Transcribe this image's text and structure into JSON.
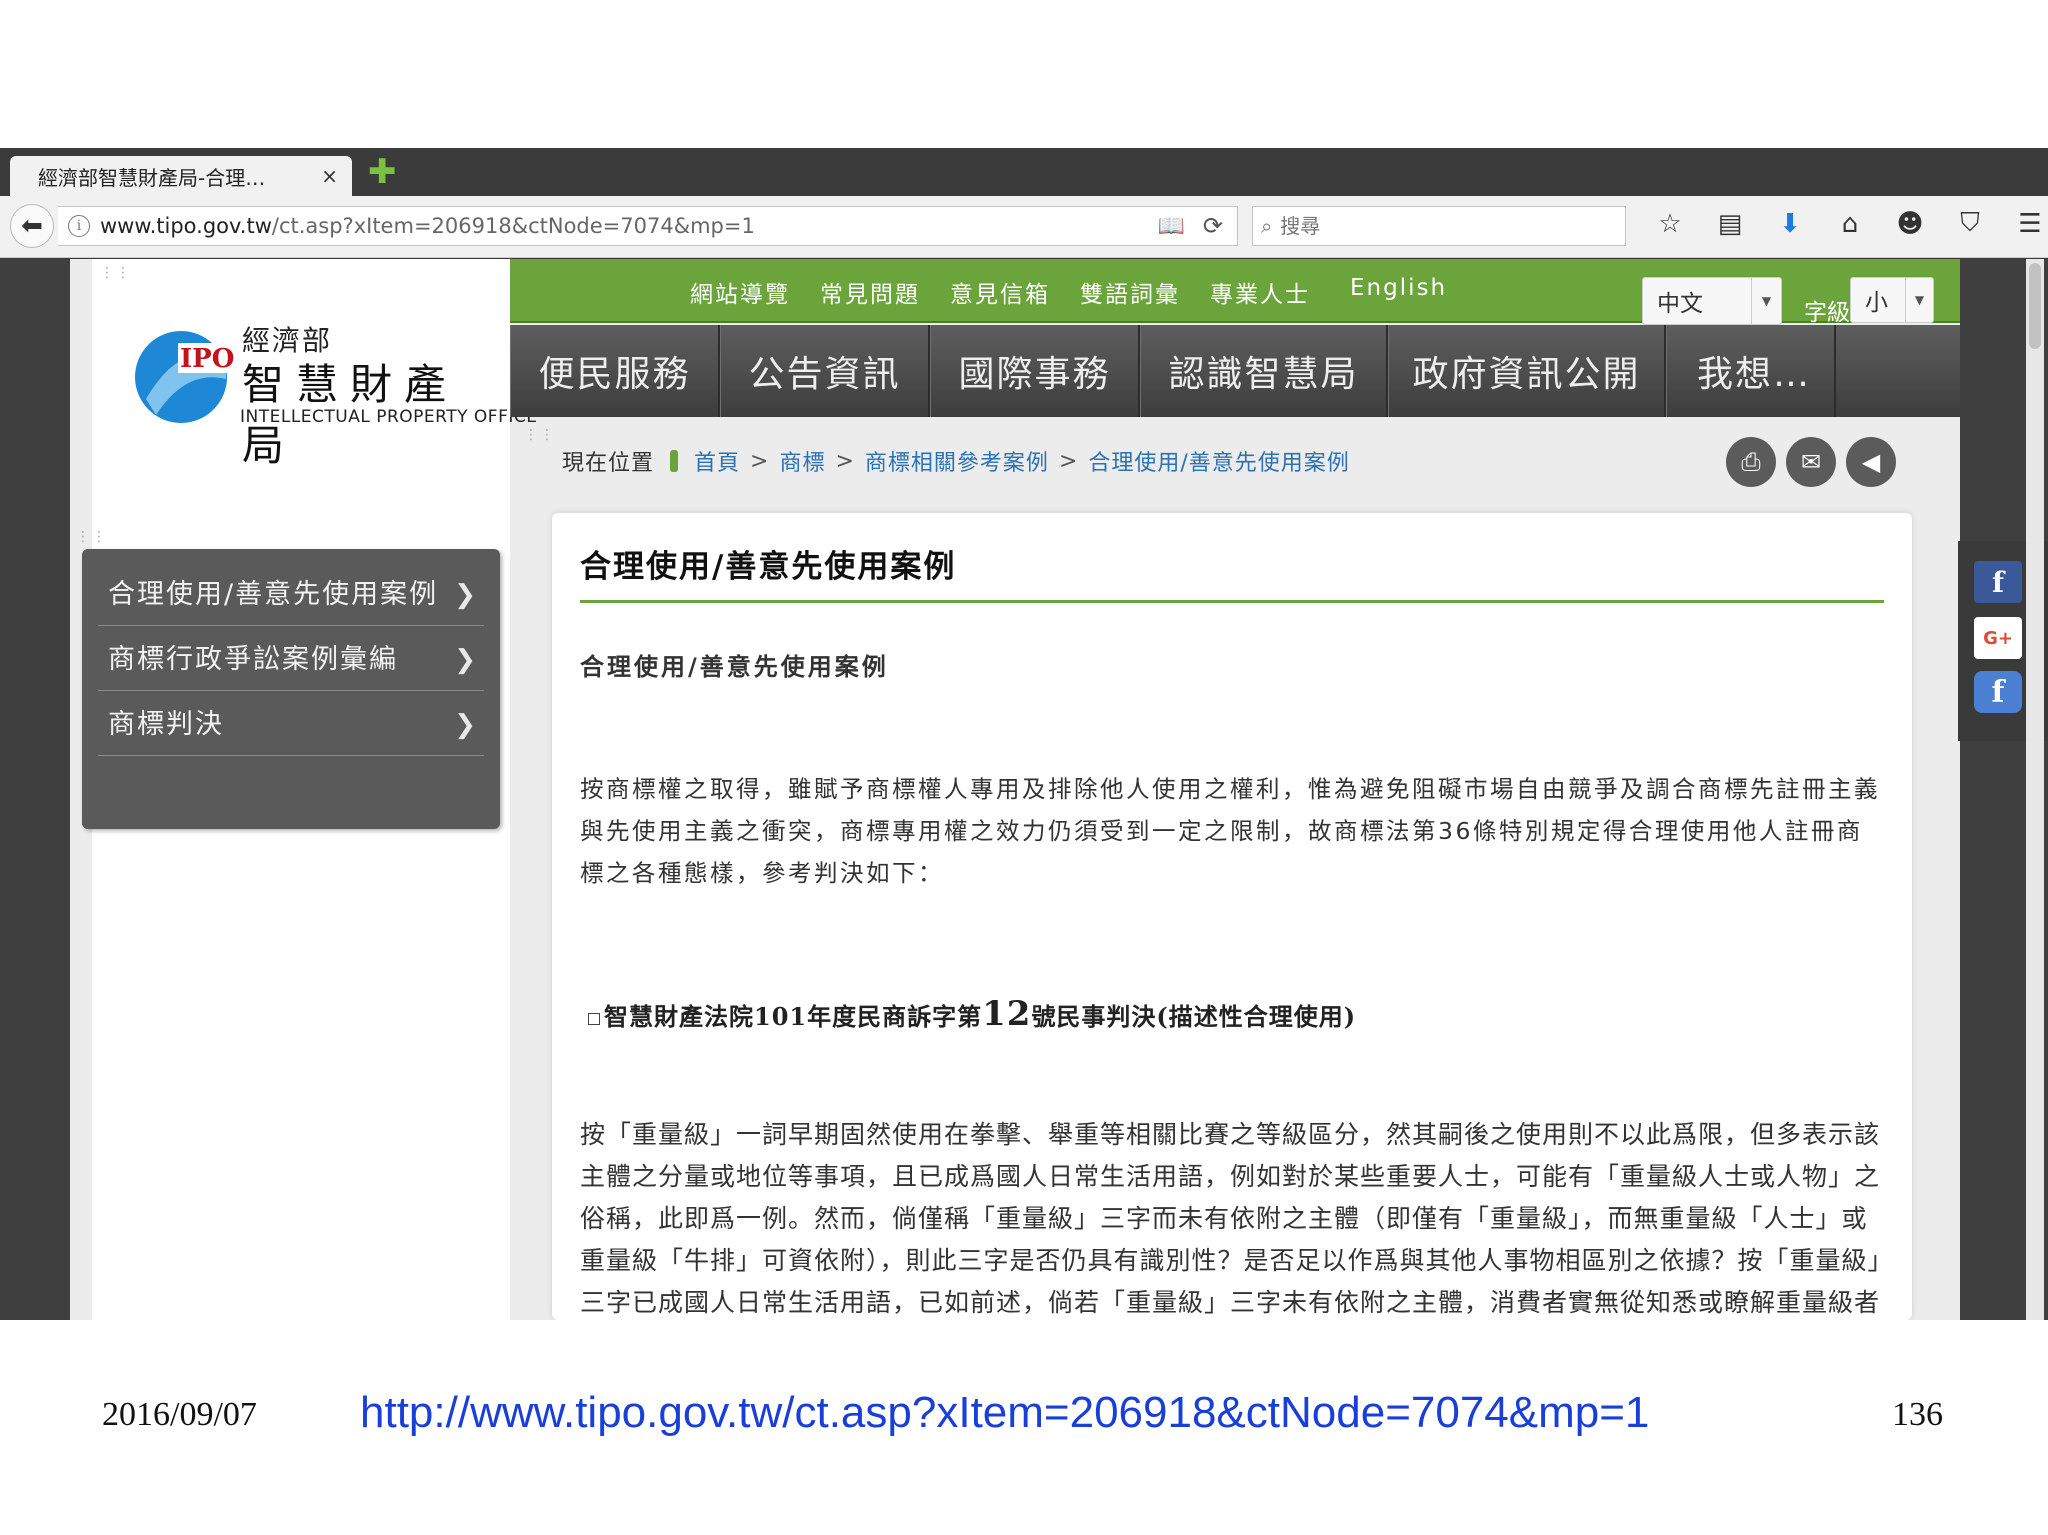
{
  "browser": {
    "tab_title": "經濟部智慧財產局-合理…",
    "tab_close": "×",
    "new_tab": "✚",
    "url_domain": "www.tipo.gov.tw",
    "url_path": "/ct.asp?xItem=206918&ctNode=7074&mp=1",
    "search_placeholder": "搜尋"
  },
  "site": {
    "logo": {
      "mark": "IPO",
      "cn_top": "經濟部",
      "cn_main": "智慧財產局",
      "en": "INTELLECTUAL PROPERTY OFFICE"
    },
    "top_nav": [
      "網站導覽",
      "常見問題",
      "意見信箱",
      "雙語詞彙",
      "專業人士",
      "English"
    ],
    "language": "中文",
    "font_size_label": "字級",
    "font_size": "小",
    "main_nav": [
      "便民服務",
      "公告資訊",
      "國際事務",
      "認識智慧局",
      "政府資訊公開",
      "我想…"
    ],
    "breadcrumb": {
      "label": "現在位置",
      "items": [
        "首頁",
        "商標",
        "商標相關參考案例",
        "合理使用/善意先使用案例"
      ],
      "separator": ">"
    },
    "side_menu": [
      {
        "label": "合理使用/善意先使用案例"
      },
      {
        "label": "商標行政爭訟案例彙編"
      },
      {
        "label": "商標判決"
      }
    ],
    "chevron": "❯",
    "article": {
      "title": "合理使用/善意先使用案例",
      "subtitle": "合理使用/善意先使用案例",
      "paragraph1": "按商標權之取得，雖賦予商標權人專用及排除他人使用之權利，惟為避免阻礙市場自由競爭及調合商標先註冊主義與先使用主義之衝突，商標專用權之效力仍須受到一定之限制，故商標法第36條特別規定得合理使用他人註冊商標之各種態樣，參考判決如下：",
      "case_heading_prefix": "智慧財產法院101年度民商訴字第",
      "case_heading_number": "12",
      "case_heading_suffix": "號民事判決(描述性合理使用)",
      "paragraph2": "按「重量級」一詞早期固然使用在拳擊、舉重等相關比賽之等級區分，然其嗣後之使用則不以此爲限，但多表示該主體之分量或地位等事項，且已成爲國人日常生活用語，例如對於某些重要人士，可能有「重量級人士或人物」之俗稱，此即爲一例。然而，倘僅稱「重量級」三字而未有依附之主體（即僅有「重量級」，而無重量級「人士」或重量級「牛排」可資依附），則此三字是否仍具有識別性？是否足以作爲與其他人事物相區別之依據？按「重量級」三字已成國人日常生活用語，已如前述，倘若「重量級」三字未有依附之主體，消費者實無從知悉或瞭解重量級者何，換言之，消費者無從單純依此三字而知悉其所謂「重量級」者係指何人、何事、"
    },
    "social": {
      "facebook": "f",
      "google_plus": "G+",
      "facebook_alt": "f"
    }
  },
  "footer": {
    "date": "2016/09/07",
    "url": "http://www.tipo.gov.tw/ct.asp?xItem=206918&ctNode=7074&mp=1",
    "page_number": "136"
  },
  "colors": {
    "accent_green": "#6aa43a",
    "link_blue": "#2a72b5",
    "footer_url": "#1a3fd8"
  }
}
